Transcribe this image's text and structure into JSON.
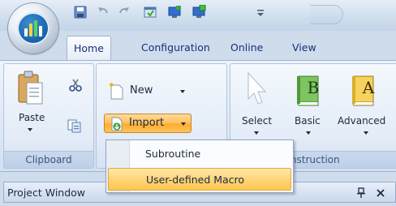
{
  "tabs": [
    {
      "label": "Home",
      "active": true
    },
    {
      "label": "Configuration",
      "active": false
    },
    {
      "label": "Online",
      "active": false
    },
    {
      "label": "View",
      "active": false
    }
  ],
  "quick_access_icons": [
    "save-icon",
    "undo-icon",
    "redo-icon",
    "window-icon",
    "monitor-blue-icon",
    "monitor-green-icon",
    "customize-chevron-icon"
  ],
  "groups": {
    "clipboard": {
      "label": "Clipboard",
      "paste": "Paste"
    },
    "program": {
      "new": "New",
      "import": "Import"
    },
    "instruction": {
      "label": "Instruction",
      "select": "Select",
      "basic": "Basic",
      "advanced": "Advanced"
    }
  },
  "book_letters": {
    "basic": "B",
    "advanced": "A"
  },
  "import_menu": {
    "items": [
      {
        "label": "Subroutine",
        "highlighted": false
      },
      {
        "label": "User-defined Macro",
        "highlighted": true
      }
    ]
  },
  "project_window": {
    "title": "Project Window",
    "pin_icon": "pin-icon",
    "close_icon": "close-icon"
  },
  "colors": {
    "highlight": "#ffc64f",
    "import_button": "#ffad2f",
    "ribbon": "#dfe9f6",
    "tab_text": "#15317a"
  }
}
